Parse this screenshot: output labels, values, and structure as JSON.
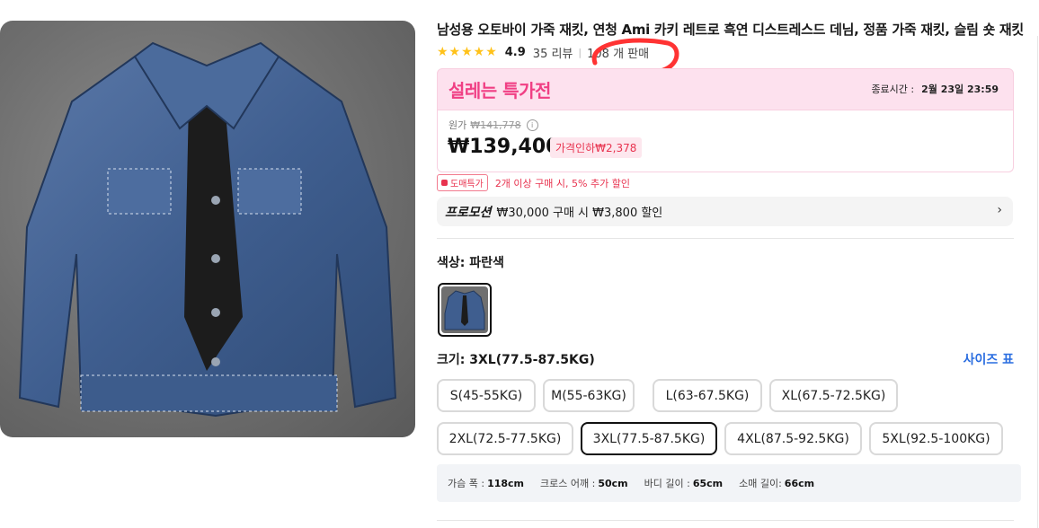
{
  "product": {
    "title": "남성용 오토바이 가죽 재킷, 연청 Ami 카키 레트로 흑연 디스트레스드 데님, 정품 가죽 재킷, 슬림 숏 재킷",
    "stars": "★★★★★",
    "rating": "4.9",
    "reviews": "35 리뷰",
    "separator": "|",
    "sold": "108 개 판매",
    "image_alt": "blue distressed leather jacket"
  },
  "deal": {
    "title": "설레는 특가전",
    "end_label": "종료시간 :",
    "end_time": "2월 23일 23:59"
  },
  "price": {
    "original_label": "원가",
    "original_value": "₩141,778",
    "info_icon": "i",
    "current": "₩139,400",
    "discount": "가격인하₩2,378"
  },
  "wholesale": {
    "tag": "도매특가",
    "text": "2개 이상 구매 시, 5% 추가 할인"
  },
  "promotion": {
    "label": "프로모션",
    "text": "₩30,000 구매 시 ₩3,800 할인",
    "chevron": "›"
  },
  "color": {
    "label": "색상: 파란색"
  },
  "size": {
    "label": "크기: 3XL(77.5-87.5KG)",
    "chart_link": "사이즈 표",
    "options": [
      "S(45-55KG)",
      "M(55-63KG)",
      "L(63-67.5KG)",
      "XL(67.5-72.5KG)",
      "2XL(72.5-77.5KG)",
      "3XL(77.5-87.5KG)",
      "4XL(87.5-92.5KG)",
      "5XL(92.5-100KG)"
    ],
    "selected": "3XL(77.5-87.5KG)"
  },
  "measurements": [
    {
      "label": "가슴 폭 :",
      "value": "118cm"
    },
    {
      "label": "크로스 어깨 :",
      "value": "50cm"
    },
    {
      "label": "바디 길이 :",
      "value": "65cm"
    },
    {
      "label": "소매 길이:",
      "value": "66cm"
    }
  ],
  "colors": {
    "deal_pink": "#f03f84",
    "discount_red": "#e8334f",
    "link_blue": "#2a6de0",
    "star": "#ffc21a",
    "annotation": "#ff3333"
  }
}
